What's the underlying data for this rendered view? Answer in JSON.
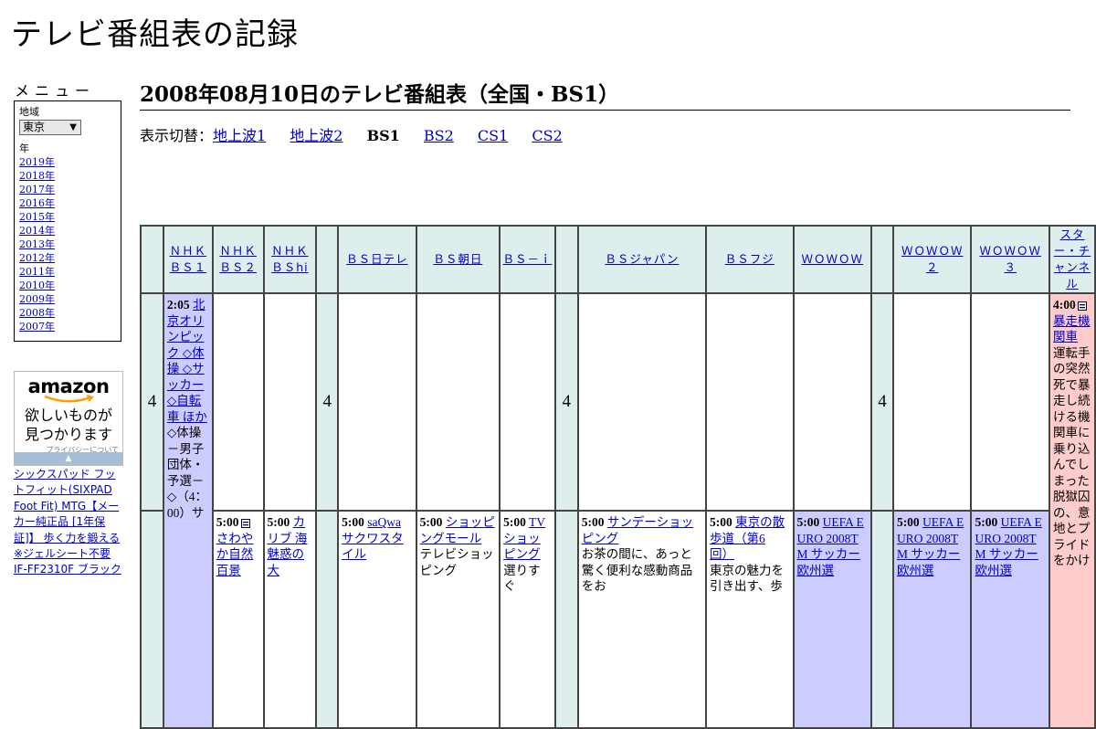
{
  "site": {
    "title": "テレビ番組表の記録"
  },
  "menu": {
    "title": "メニュー",
    "region_label": "地域",
    "region_selected": "東京",
    "year_label": "年",
    "years": [
      "2019年",
      "2018年",
      "2017年",
      "2016年",
      "2015年",
      "2014年",
      "2013年",
      "2012年",
      "2011年",
      "2010年",
      "2009年",
      "2008年",
      "2007年"
    ]
  },
  "ad": {
    "logo": "amazon",
    "tagline_1": "欲しいものが",
    "tagline_2": "見つかります",
    "privacy": "プライバシーについて",
    "product": "シックスパッド フットフィット(SIXPAD Foot Fit) MTG【メーカー純正品 [1年保証]】 歩く力を鍛える ※ジェルシート不要 IF-FF2310F ブラック"
  },
  "page": {
    "heading": "2008年08月10日のテレビ番組表（全国・BS1）"
  },
  "switch": {
    "label": "表示切替：",
    "links": [
      "地上波1",
      "地上波2",
      "BS2",
      "CS1",
      "CS2"
    ],
    "current": "BS1"
  },
  "channels": [
    "ＮＨＫＢＳ１",
    "ＮＨＫＢＳ２",
    "ＮＨＫ ＢＳhi",
    "ＢＳ日テレ",
    "ＢＳ朝日",
    "ＢＳ－ｉ",
    "ＢＳジャパン",
    "ＢＳフジ",
    "ＷＯＷＯＷ",
    "ＷＯＷＯＷ２",
    "ＷＯＷＯＷ３",
    "スター・チャンネル"
  ],
  "hour": "4",
  "programs": {
    "nhkbs1_205": {
      "time": "2:05",
      "title": "北京オリンピック ◇体操 ◇サッカー ◇自転車 ほか",
      "desc": "◇体操 －男子団体・予選－ ◇（4：00）サ"
    },
    "nhkbs2_500": {
      "time": "5:00",
      "title": "さわやか自然百景"
    },
    "bshi_500": {
      "time": "5:00",
      "title": "カリブ 海 魅惑の大"
    },
    "bsntv_500": {
      "time": "5:00",
      "title": "saQwa サクワスタイル"
    },
    "bsasahi_500": {
      "time": "5:00",
      "title": "ショッピングモール",
      "desc": "テレビショッピング"
    },
    "bsi_500": {
      "time": "5:00",
      "title": "TVショッピング",
      "desc": "選りすぐ"
    },
    "bsjapan_500": {
      "time": "5:00",
      "title": "サンデーショッピング",
      "desc": "お茶の間に、あっと驚く便利な感動商品をお"
    },
    "bsfuji_500": {
      "time": "5:00",
      "title": "東京の散歩道（第6回）",
      "desc": "東京の魅力を引き出す、歩"
    },
    "wowow_500": {
      "time": "5:00",
      "title": "UEFA EURO 2008TM サッカー欧州選"
    },
    "wowow2_500": {
      "time": "5:00",
      "title": "UEFA EURO 2008TM サッカー欧州選"
    },
    "wowow3_500": {
      "time": "5:00",
      "title": "UEFA EURO 2008TM サッカー欧州選"
    },
    "star_400": {
      "time": "4:00",
      "title": "暴走機関車",
      "desc": "運転手の突然死で暴走し続ける機関車に乗り込んでしまった脱獄囚の、意地とプライドをかけ"
    }
  }
}
